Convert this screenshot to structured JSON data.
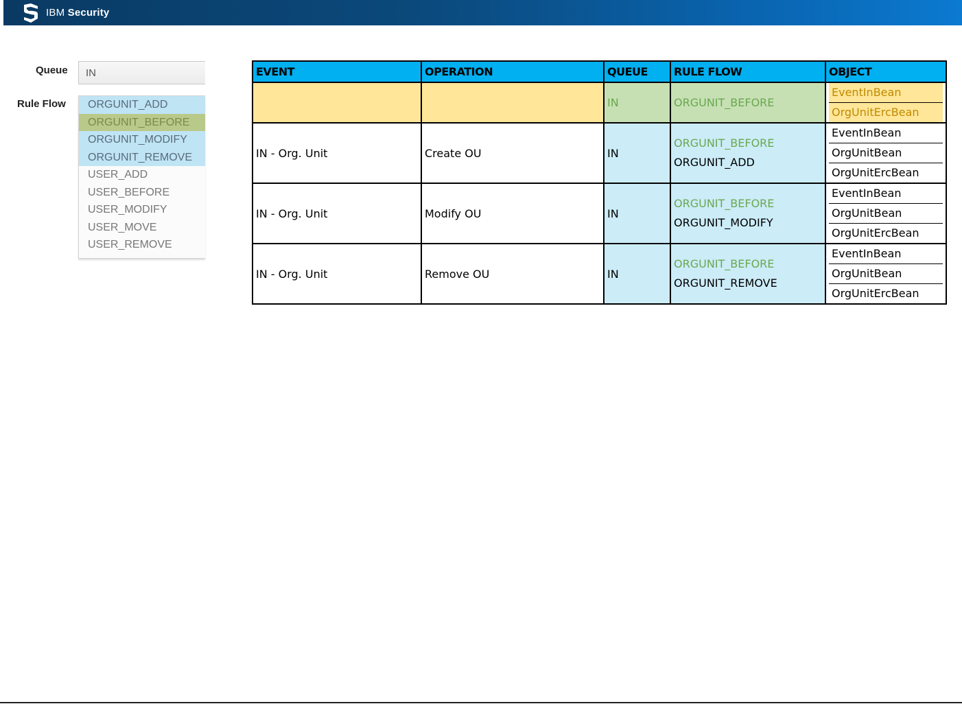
{
  "header": {
    "brand_prefix": "IBM",
    "brand_name": "Security"
  },
  "form": {
    "queue_label": "Queue",
    "queue_value": "IN",
    "rule_flow_label": "Rule Flow",
    "rule_flow_items": [
      {
        "label": "ORGUNIT_ADD",
        "state": "selected"
      },
      {
        "label": "ORGUNIT_BEFORE",
        "state": "highlighted"
      },
      {
        "label": "ORGUNIT_MODIFY",
        "state": "selected"
      },
      {
        "label": "ORGUNIT_REMOVE",
        "state": "selected"
      },
      {
        "label": "USER_ADD",
        "state": "normal"
      },
      {
        "label": "USER_BEFORE",
        "state": "normal"
      },
      {
        "label": "USER_MODIFY",
        "state": "normal"
      },
      {
        "label": "USER_MOVE",
        "state": "normal"
      },
      {
        "label": "USER_REMOVE",
        "state": "normal"
      }
    ]
  },
  "table": {
    "headers": [
      "EVENT",
      "OPERATION",
      "QUEUE",
      "RULE FLOW",
      "OBJECT"
    ],
    "header_color": "#00b0f0",
    "rows": [
      {
        "event": "",
        "operation": "",
        "queue": "IN",
        "rule_before": "ORGUNIT_BEFORE",
        "rule_main": "",
        "objects": [
          "EventInBean",
          "OrgUnitErcBean"
        ]
      },
      {
        "event": "IN - Org. Unit",
        "operation": "Create OU",
        "queue": "IN",
        "rule_before": "ORGUNIT_BEFORE",
        "rule_main": "ORGUNIT_ADD",
        "objects": [
          "EventInBean",
          "OrgUnitBean",
          "OrgUnitErcBean"
        ]
      },
      {
        "event": "IN - Org. Unit",
        "operation": "Modify OU",
        "queue": "IN",
        "rule_before": "ORGUNIT_BEFORE",
        "rule_main": "ORGUNIT_MODIFY",
        "objects": [
          "EventInBean",
          "OrgUnitBean",
          "OrgUnitErcBean"
        ]
      },
      {
        "event": "IN - Org. Unit",
        "operation": "Remove OU",
        "queue": "IN",
        "rule_before": "ORGUNIT_BEFORE",
        "rule_main": "ORGUNIT_REMOVE",
        "objects": [
          "EventInBean",
          "OrgUnitBean",
          "OrgUnitErcBean"
        ]
      }
    ]
  }
}
